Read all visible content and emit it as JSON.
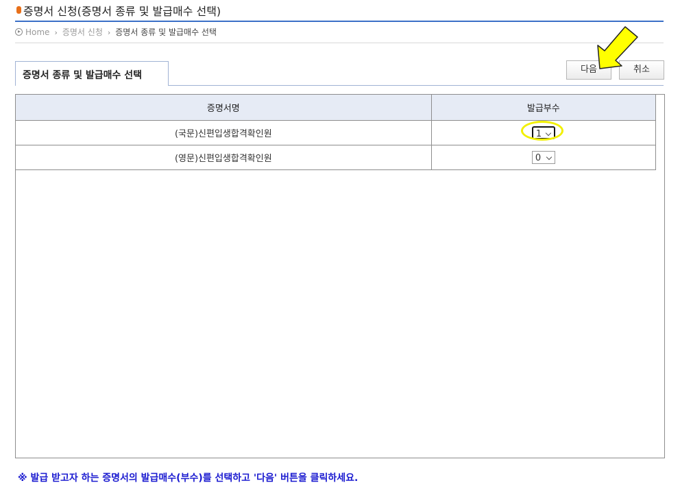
{
  "header": {
    "title": "증명서 신청(증명서 종류 및 발급매수 선택)"
  },
  "breadcrumb": {
    "home": "Home",
    "level1": "증명서 신청",
    "level2": "증명서 종류 및 발급매수 선택"
  },
  "tab": {
    "label": "증명서 종류 및 발급매수 선택"
  },
  "buttons": {
    "next": "다음",
    "cancel": "취소"
  },
  "table": {
    "headers": [
      "증명서명",
      "발급부수"
    ],
    "rows": [
      {
        "name": "(국문)신편입생합격확인원",
        "copies": "1"
      },
      {
        "name": "(영문)신편입생합격확인원",
        "copies": "0"
      }
    ]
  },
  "notice": "※ 발급 받고자 하는 증명서의 발급매수(부수)를 선택하고 '다음' 버튼을 클릭하세요.",
  "colors": {
    "accent": "#3a6fc7",
    "highlight": "#f2f000",
    "notice": "#1a1ad0"
  }
}
